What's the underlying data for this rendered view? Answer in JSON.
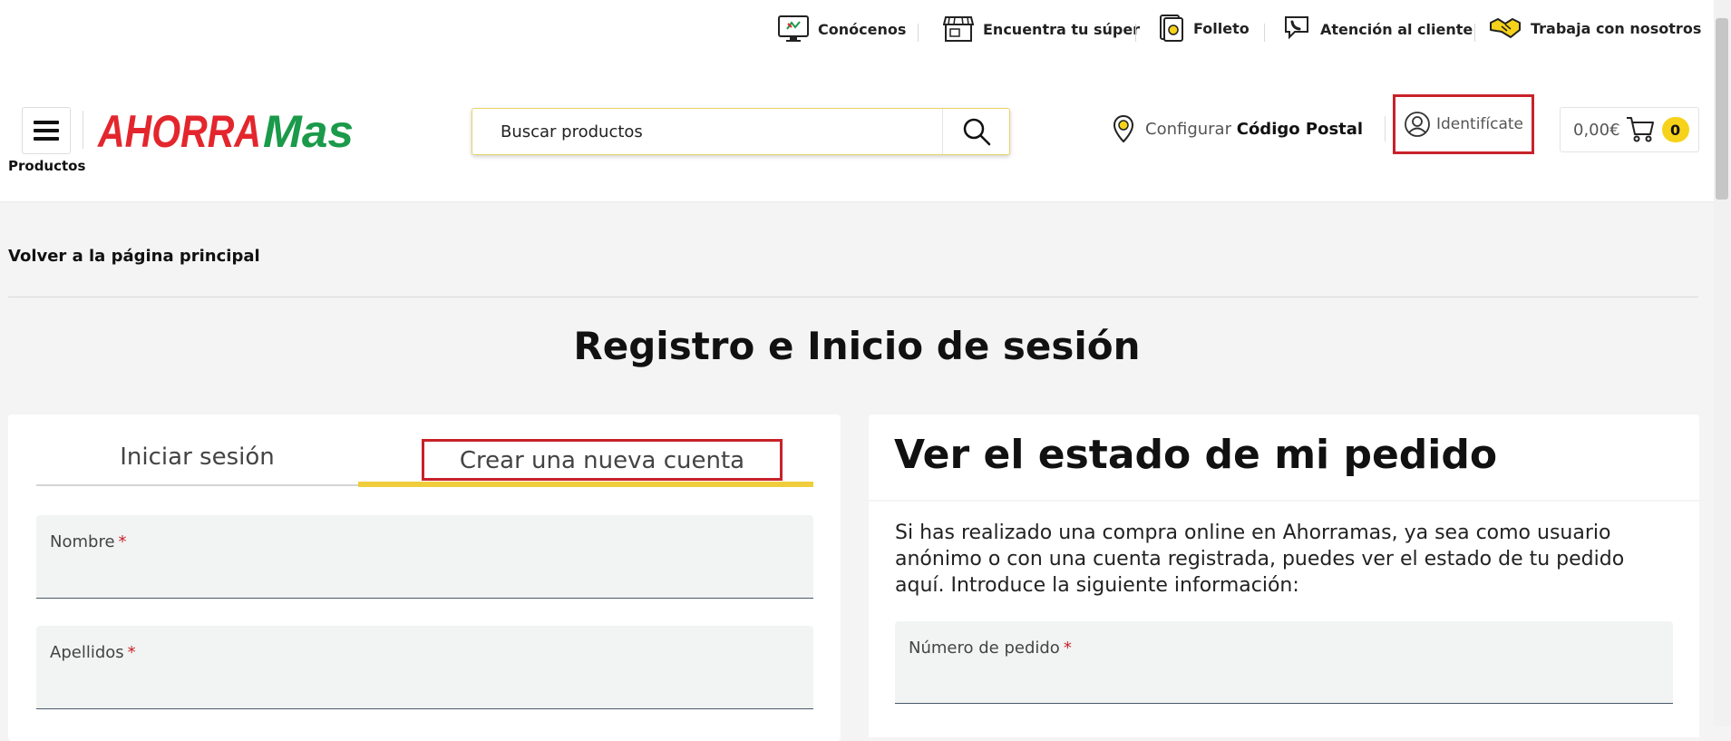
{
  "top_nav": [
    {
      "label": "Conócenos",
      "icon": "monitor-icon"
    },
    {
      "label": "Encuentra tu súper",
      "icon": "store-icon"
    },
    {
      "label": "Folleto",
      "icon": "leaflet-icon"
    },
    {
      "label": "Atención al cliente",
      "icon": "phone-icon"
    },
    {
      "label": "Trabaja con nosotros",
      "icon": "handshake-icon"
    }
  ],
  "header": {
    "menu_label": "Productos",
    "logo": {
      "part1": "AHORRA",
      "part2": "Mas",
      "color1": "#e3262d",
      "color2": "#1a9a4a"
    },
    "search_placeholder": "Buscar productos",
    "postal_prefix": "Configurar",
    "postal_bold": "Código Postal",
    "login_label": "Identifícate",
    "cart_total": "0,00€",
    "cart_count": "0"
  },
  "main": {
    "back_link": "Volver a la página principal",
    "title": "Registro e Inicio de sesión",
    "tabs": {
      "login": "Iniciar sesión",
      "register": "Crear una nueva cuenta"
    },
    "fields": {
      "nombre": "Nombre",
      "apellidos": "Apellidos",
      "required_mark": "*"
    },
    "order_status": {
      "title": "Ver el estado de mi pedido",
      "description": "Si has realizado una compra online en Ahorramas, ya sea como usuario anónimo o con una cuenta registrada, puedes ver el estado de tu pedido aquí. Introduce la siguiente información:",
      "order_field": "Número de pedido"
    }
  },
  "colors": {
    "accent_yellow": "#f0cd3c",
    "highlight_red": "#c8222a"
  }
}
